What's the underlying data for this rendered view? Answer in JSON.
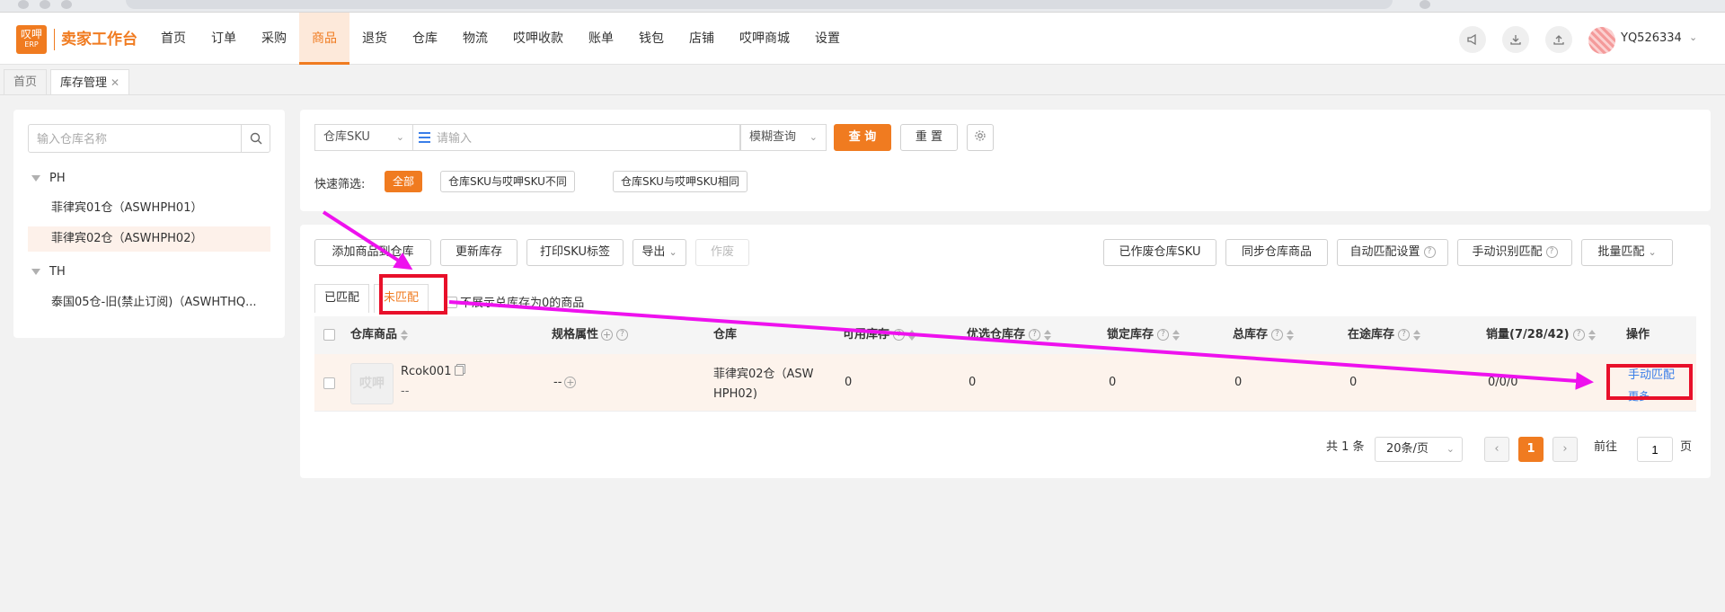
{
  "header": {
    "logo_text": "叹呷",
    "logo_sub": "ERP",
    "brand": "卖家工作台",
    "nav": [
      {
        "label": "首页",
        "active": false
      },
      {
        "label": "订单",
        "active": false
      },
      {
        "label": "采购",
        "active": false
      },
      {
        "label": "商品",
        "active": true
      },
      {
        "label": "退货",
        "active": false
      },
      {
        "label": "仓库",
        "active": false
      },
      {
        "label": "物流",
        "active": false
      },
      {
        "label": "哎呷收款",
        "active": false
      },
      {
        "label": "账单",
        "active": false
      },
      {
        "label": "钱包",
        "active": false
      },
      {
        "label": "店铺",
        "active": false
      },
      {
        "label": "哎呷商城",
        "active": false
      },
      {
        "label": "设置",
        "active": false
      }
    ],
    "username": "YQ526334",
    "icons": [
      "megaphone-icon",
      "download-icon",
      "upload-icon"
    ]
  },
  "page_tabs": [
    {
      "label": "首页",
      "active": false
    },
    {
      "label": "库存管理",
      "active": true,
      "closable": true
    }
  ],
  "warehouse_panel": {
    "search_placeholder": "输入仓库名称",
    "tree": [
      {
        "type": "group",
        "label": "PH"
      },
      {
        "type": "leaf",
        "label": "菲律宾01仓（ASWHPH01）",
        "selected": false
      },
      {
        "type": "leaf",
        "label": "菲律宾02仓（ASWHPH02）",
        "selected": true
      },
      {
        "type": "group",
        "label": "TH"
      },
      {
        "type": "leaf",
        "label": "泰国05仓-旧(禁止订阅)（ASWHTHQ...",
        "selected": false
      }
    ]
  },
  "search": {
    "field_select": "仓库SKU",
    "keyword_placeholder": "请输入",
    "mode_select": "模糊查询",
    "query_label": "查 询",
    "reset_label": "重 置",
    "quick_filter_label": "快速筛选:",
    "quick_filters": [
      {
        "label": "全部",
        "active": true
      },
      {
        "label": "仓库SKU与哎呷SKU不同",
        "active": false
      },
      {
        "label": "仓库SKU与哎呷SKU相同",
        "active": false
      }
    ]
  },
  "toolbar": {
    "left": [
      "添加商品到仓库",
      "更新库存",
      "打印SKU标签",
      "导出",
      "作废"
    ],
    "right": [
      "已作废仓库SKU",
      "同步仓库商品",
      "自动匹配设置",
      "手动识别匹配",
      "批量匹配"
    ]
  },
  "sub_tabs": [
    {
      "label": "已匹配",
      "active": false
    },
    {
      "label": "未匹配",
      "active": true
    }
  ],
  "hide_zero_label": "不展示总库存为0的商品",
  "table": {
    "columns": [
      "仓库商品",
      "规格属性",
      "仓库",
      "可用库存",
      "优选仓库存",
      "锁定库存",
      "总库存",
      "在途库存",
      "销量(7/28/42)",
      "操作"
    ],
    "rows": [
      {
        "thumb": "哎呷",
        "sku": "Rcok001",
        "sub": "--",
        "spec": "--",
        "warehouse_line1": "菲律宾02仓（ASW",
        "warehouse_line2": "HPH02)",
        "available": "0",
        "preferred": "0",
        "locked": "0",
        "total": "0",
        "in_transit": "0",
        "sales": "0/0/0",
        "action_primary": "手动匹配",
        "action_more": "更多"
      }
    ]
  },
  "pagination": {
    "total_text": "共 1 条",
    "page_size": "20条/页",
    "current_page": "1",
    "goto_label": "前往",
    "goto_value": "1",
    "page_suffix": "页"
  },
  "colors": {
    "accent": "#f07b20",
    "link": "#3a7ee8",
    "annotation_red": "#e8102a",
    "annotation_arrow": "#ee11ee"
  }
}
